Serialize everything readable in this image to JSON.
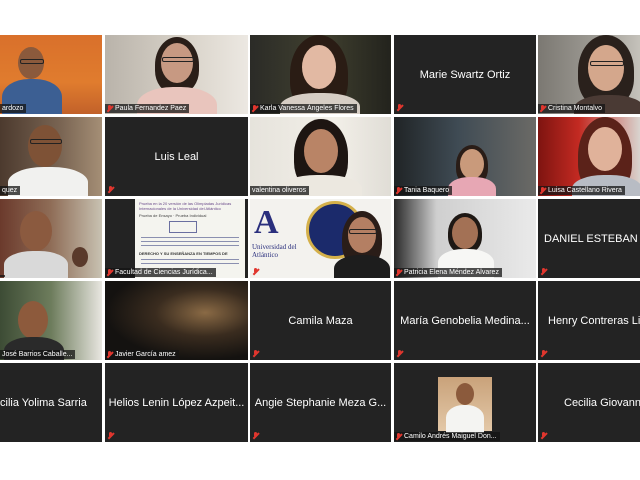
{
  "participants": [
    {
      "name": "ardozo",
      "speaking": false
    },
    {
      "name": "Paula Fernandez Paez"
    },
    {
      "name": "Karla Vanessa Ángeles Flores"
    },
    {
      "name": "Marie Swartz Ortiz"
    },
    {
      "name": "Cristina Montalvo"
    },
    {
      "name": "quez"
    },
    {
      "name": "Luis Leal"
    },
    {
      "name": "valentina oliveros"
    },
    {
      "name": "Tania Baquero"
    },
    {
      "name": "Luisa Castellano Rivera"
    },
    {
      "name": ""
    },
    {
      "name": "Facultad de Ciencias Jurídica..."
    },
    {
      "name": "Universidad del Atlántico"
    },
    {
      "name": "Patricia Elena Méndez Alvarez"
    },
    {
      "name": "DANIEL ESTEBAN M"
    },
    {
      "name": "José Barrios Caballe..."
    },
    {
      "name": "Javier García amez"
    },
    {
      "name": "Camila Maza"
    },
    {
      "name": "María Genobelia Medina..."
    },
    {
      "name": "Henry Contreras Lic"
    },
    {
      "name": "cilia Yolima Sarria"
    },
    {
      "name": "Helios Lenin López Azpeit..."
    },
    {
      "name": "Angie Stephanie Meza G..."
    },
    {
      "name": "Camilo Andrés Maiguel Don..."
    },
    {
      "name": "Cecilia Giovanne"
    }
  ],
  "shared_doc": {
    "header": "Prueba en la 20 versión de las Olimpiadas Jurídicas Internacionales de la Universidad del Atlántico",
    "subhead": "Prueba de Ensayo  ·  Prueba Individual",
    "body": "DERECHO Y SU ENSEÑANZA EN TIEMPOS DE"
  },
  "colors": {
    "tile_bg": "#232323",
    "active_speaker_border": "#c8dc3a",
    "muted_mic": "#e0362e"
  }
}
